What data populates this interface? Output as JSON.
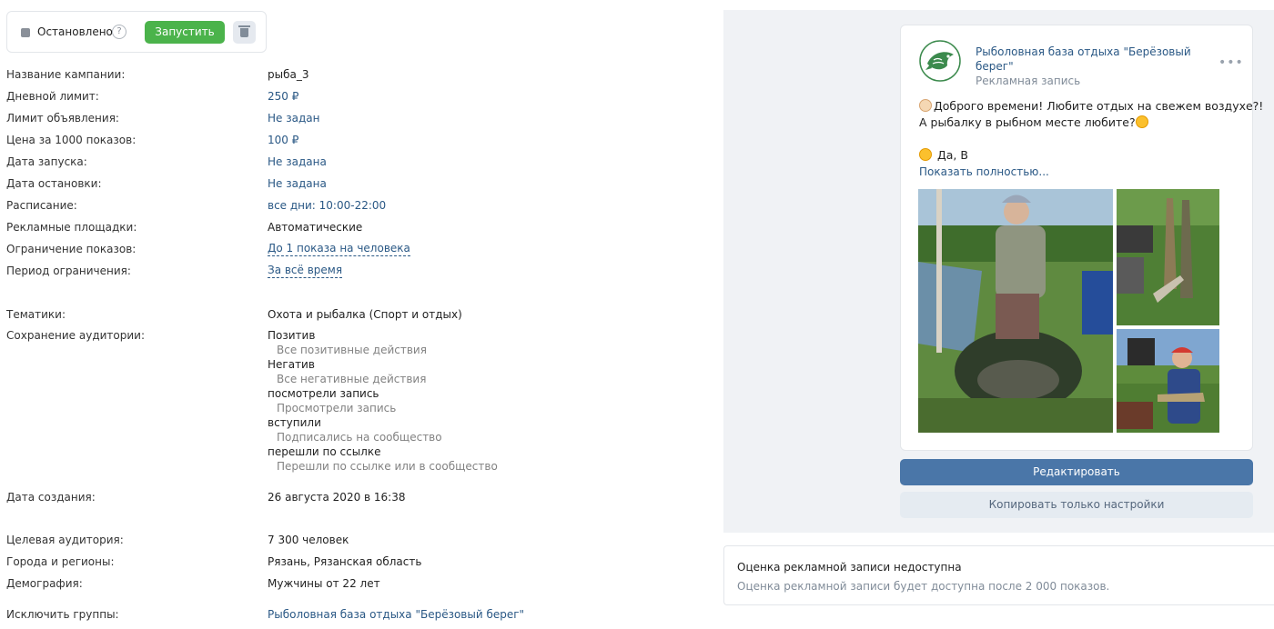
{
  "status": {
    "label": "Остановлено",
    "help": "?",
    "run_label": "Запустить"
  },
  "details": {
    "campaign_name": {
      "label": "Название кампании:",
      "value": "рыба_3"
    },
    "daily_limit": {
      "label": "Дневной лимит:",
      "value": "250 ₽"
    },
    "ad_limit": {
      "label": "Лимит объявления:",
      "value": "Не задан"
    },
    "price_1000": {
      "label": "Цена за 1000 показов:",
      "value": "100 ₽"
    },
    "start_date": {
      "label": "Дата запуска:",
      "value": "Не задана"
    },
    "stop_date": {
      "label": "Дата остановки:",
      "value": "Не задана"
    },
    "schedule": {
      "label": "Расписание:",
      "value": "все дни: 10:00-22:00"
    },
    "platforms": {
      "label": "Рекламные площадки:",
      "value": "Автоматические"
    },
    "impression_limit": {
      "label": "Ограничение показов:",
      "value": "До 1 показа на человека"
    },
    "limit_period": {
      "label": "Период ограничения:",
      "value": "За всё время"
    },
    "topics": {
      "label": "Тематики:",
      "value": "Охота и рыбалка (Спорт и отдых)"
    },
    "audience_saving": {
      "label": "Сохранение аудитории:"
    },
    "created": {
      "label": "Дата создания:",
      "value": "26 августа 2020 в 16:38"
    },
    "target_audience": {
      "label": "Целевая аудитория:",
      "value": "7 300 человек"
    },
    "regions": {
      "label": "Города и регионы:",
      "value": "Рязань, Рязанская область"
    },
    "demography": {
      "label": "Демография:",
      "value": "Мужчины от 22 лет"
    },
    "exclude_groups": {
      "label": "Исключить группы:",
      "value": "Рыболовная база отдыха \"Берёзовый берег\""
    }
  },
  "audiences": [
    {
      "name": "Позитив",
      "desc": "Все позитивные действия"
    },
    {
      "name": "Негатив",
      "desc": "Все негативные действия"
    },
    {
      "name": "посмотрели запись",
      "desc": "Просмотрели запись"
    },
    {
      "name": "вступили",
      "desc": "Подписались на сообщество"
    },
    {
      "name": "перешли по ссылке",
      "desc": "Перешли по ссылке или в сообщество"
    }
  ],
  "post": {
    "group_name": "Рыболовная база отдыха \"Берёзовый берег\"",
    "subtitle": "Рекламная запись",
    "more": "•••",
    "line1": "Доброго времени! Любите отдых на свежем воздухе?!",
    "line2": "А рыбалку в рыбном месте любите?",
    "line3": "Да, В",
    "show_more": "Показать полностью..."
  },
  "buttons": {
    "edit": "Редактировать",
    "copy": "Копировать только настройки"
  },
  "rating": {
    "title": "Оценка рекламной записи недоступна",
    "subtitle": "Оценка рекламной записи будет доступна после 2 000 показов."
  },
  "colors": {
    "accent": "#4a76a8",
    "link": "#2a5885",
    "run_green": "#4bb34b",
    "panel_bg": "#f0f2f5"
  },
  "icons": [
    "help-icon",
    "trash-icon",
    "more-dots-icon",
    "fish-logo-icon",
    "waving-hand-emoji",
    "flushed-face-emoji",
    "winking-face-emoji"
  ]
}
